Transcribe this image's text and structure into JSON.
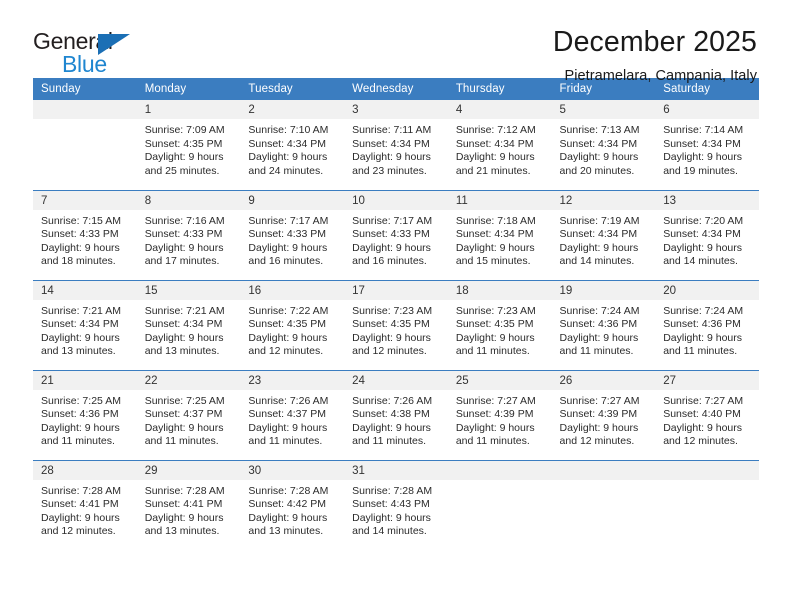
{
  "logo": {
    "word_one": "General",
    "word_two": "Blue",
    "triangle_icon": "triangle-icon",
    "color_dark": "#231f20",
    "color_blue": "#1f86d0",
    "color_triangle": "#1b6fb5"
  },
  "header": {
    "title": "December 2025",
    "subtitle": "Pietramelara, Campania, Italy"
  },
  "theme": {
    "header_bg": "#3b7dc0",
    "header_text": "#ffffff",
    "daynum_bg": "#f1f1f1",
    "grid_line": "#3b7dc0"
  },
  "calendar": {
    "weekday_headers": [
      "Sunday",
      "Monday",
      "Tuesday",
      "Wednesday",
      "Thursday",
      "Friday",
      "Saturday"
    ],
    "weeks": [
      [
        {
          "day": "",
          "empty": true,
          "sunrise": "",
          "sunset": "",
          "daylight_line1": "",
          "daylight_line2": ""
        },
        {
          "day": "1",
          "sunrise": "Sunrise: 7:09 AM",
          "sunset": "Sunset: 4:35 PM",
          "daylight_line1": "Daylight: 9 hours",
          "daylight_line2": "and 25 minutes."
        },
        {
          "day": "2",
          "sunrise": "Sunrise: 7:10 AM",
          "sunset": "Sunset: 4:34 PM",
          "daylight_line1": "Daylight: 9 hours",
          "daylight_line2": "and 24 minutes."
        },
        {
          "day": "3",
          "sunrise": "Sunrise: 7:11 AM",
          "sunset": "Sunset: 4:34 PM",
          "daylight_line1": "Daylight: 9 hours",
          "daylight_line2": "and 23 minutes."
        },
        {
          "day": "4",
          "sunrise": "Sunrise: 7:12 AM",
          "sunset": "Sunset: 4:34 PM",
          "daylight_line1": "Daylight: 9 hours",
          "daylight_line2": "and 21 minutes."
        },
        {
          "day": "5",
          "sunrise": "Sunrise: 7:13 AM",
          "sunset": "Sunset: 4:34 PM",
          "daylight_line1": "Daylight: 9 hours",
          "daylight_line2": "and 20 minutes."
        },
        {
          "day": "6",
          "sunrise": "Sunrise: 7:14 AM",
          "sunset": "Sunset: 4:34 PM",
          "daylight_line1": "Daylight: 9 hours",
          "daylight_line2": "and 19 minutes."
        }
      ],
      [
        {
          "day": "7",
          "sunrise": "Sunrise: 7:15 AM",
          "sunset": "Sunset: 4:33 PM",
          "daylight_line1": "Daylight: 9 hours",
          "daylight_line2": "and 18 minutes."
        },
        {
          "day": "8",
          "sunrise": "Sunrise: 7:16 AM",
          "sunset": "Sunset: 4:33 PM",
          "daylight_line1": "Daylight: 9 hours",
          "daylight_line2": "and 17 minutes."
        },
        {
          "day": "9",
          "sunrise": "Sunrise: 7:17 AM",
          "sunset": "Sunset: 4:33 PM",
          "daylight_line1": "Daylight: 9 hours",
          "daylight_line2": "and 16 minutes."
        },
        {
          "day": "10",
          "sunrise": "Sunrise: 7:17 AM",
          "sunset": "Sunset: 4:33 PM",
          "daylight_line1": "Daylight: 9 hours",
          "daylight_line2": "and 16 minutes."
        },
        {
          "day": "11",
          "sunrise": "Sunrise: 7:18 AM",
          "sunset": "Sunset: 4:34 PM",
          "daylight_line1": "Daylight: 9 hours",
          "daylight_line2": "and 15 minutes."
        },
        {
          "day": "12",
          "sunrise": "Sunrise: 7:19 AM",
          "sunset": "Sunset: 4:34 PM",
          "daylight_line1": "Daylight: 9 hours",
          "daylight_line2": "and 14 minutes."
        },
        {
          "day": "13",
          "sunrise": "Sunrise: 7:20 AM",
          "sunset": "Sunset: 4:34 PM",
          "daylight_line1": "Daylight: 9 hours",
          "daylight_line2": "and 14 minutes."
        }
      ],
      [
        {
          "day": "14",
          "sunrise": "Sunrise: 7:21 AM",
          "sunset": "Sunset: 4:34 PM",
          "daylight_line1": "Daylight: 9 hours",
          "daylight_line2": "and 13 minutes."
        },
        {
          "day": "15",
          "sunrise": "Sunrise: 7:21 AM",
          "sunset": "Sunset: 4:34 PM",
          "daylight_line1": "Daylight: 9 hours",
          "daylight_line2": "and 13 minutes."
        },
        {
          "day": "16",
          "sunrise": "Sunrise: 7:22 AM",
          "sunset": "Sunset: 4:35 PM",
          "daylight_line1": "Daylight: 9 hours",
          "daylight_line2": "and 12 minutes."
        },
        {
          "day": "17",
          "sunrise": "Sunrise: 7:23 AM",
          "sunset": "Sunset: 4:35 PM",
          "daylight_line1": "Daylight: 9 hours",
          "daylight_line2": "and 12 minutes."
        },
        {
          "day": "18",
          "sunrise": "Sunrise: 7:23 AM",
          "sunset": "Sunset: 4:35 PM",
          "daylight_line1": "Daylight: 9 hours",
          "daylight_line2": "and 11 minutes."
        },
        {
          "day": "19",
          "sunrise": "Sunrise: 7:24 AM",
          "sunset": "Sunset: 4:36 PM",
          "daylight_line1": "Daylight: 9 hours",
          "daylight_line2": "and 11 minutes."
        },
        {
          "day": "20",
          "sunrise": "Sunrise: 7:24 AM",
          "sunset": "Sunset: 4:36 PM",
          "daylight_line1": "Daylight: 9 hours",
          "daylight_line2": "and 11 minutes."
        }
      ],
      [
        {
          "day": "21",
          "sunrise": "Sunrise: 7:25 AM",
          "sunset": "Sunset: 4:36 PM",
          "daylight_line1": "Daylight: 9 hours",
          "daylight_line2": "and 11 minutes."
        },
        {
          "day": "22",
          "sunrise": "Sunrise: 7:25 AM",
          "sunset": "Sunset: 4:37 PM",
          "daylight_line1": "Daylight: 9 hours",
          "daylight_line2": "and 11 minutes."
        },
        {
          "day": "23",
          "sunrise": "Sunrise: 7:26 AM",
          "sunset": "Sunset: 4:37 PM",
          "daylight_line1": "Daylight: 9 hours",
          "daylight_line2": "and 11 minutes."
        },
        {
          "day": "24",
          "sunrise": "Sunrise: 7:26 AM",
          "sunset": "Sunset: 4:38 PM",
          "daylight_line1": "Daylight: 9 hours",
          "daylight_line2": "and 11 minutes."
        },
        {
          "day": "25",
          "sunrise": "Sunrise: 7:27 AM",
          "sunset": "Sunset: 4:39 PM",
          "daylight_line1": "Daylight: 9 hours",
          "daylight_line2": "and 11 minutes."
        },
        {
          "day": "26",
          "sunrise": "Sunrise: 7:27 AM",
          "sunset": "Sunset: 4:39 PM",
          "daylight_line1": "Daylight: 9 hours",
          "daylight_line2": "and 12 minutes."
        },
        {
          "day": "27",
          "sunrise": "Sunrise: 7:27 AM",
          "sunset": "Sunset: 4:40 PM",
          "daylight_line1": "Daylight: 9 hours",
          "daylight_line2": "and 12 minutes."
        }
      ],
      [
        {
          "day": "28",
          "sunrise": "Sunrise: 7:28 AM",
          "sunset": "Sunset: 4:41 PM",
          "daylight_line1": "Daylight: 9 hours",
          "daylight_line2": "and 12 minutes."
        },
        {
          "day": "29",
          "sunrise": "Sunrise: 7:28 AM",
          "sunset": "Sunset: 4:41 PM",
          "daylight_line1": "Daylight: 9 hours",
          "daylight_line2": "and 13 minutes."
        },
        {
          "day": "30",
          "sunrise": "Sunrise: 7:28 AM",
          "sunset": "Sunset: 4:42 PM",
          "daylight_line1": "Daylight: 9 hours",
          "daylight_line2": "and 13 minutes."
        },
        {
          "day": "31",
          "sunrise": "Sunrise: 7:28 AM",
          "sunset": "Sunset: 4:43 PM",
          "daylight_line1": "Daylight: 9 hours",
          "daylight_line2": "and 14 minutes."
        },
        {
          "day": "",
          "empty": true,
          "sunrise": "",
          "sunset": "",
          "daylight_line1": "",
          "daylight_line2": ""
        },
        {
          "day": "",
          "empty": true,
          "sunrise": "",
          "sunset": "",
          "daylight_line1": "",
          "daylight_line2": ""
        },
        {
          "day": "",
          "empty": true,
          "sunrise": "",
          "sunset": "",
          "daylight_line1": "",
          "daylight_line2": ""
        }
      ]
    ]
  }
}
